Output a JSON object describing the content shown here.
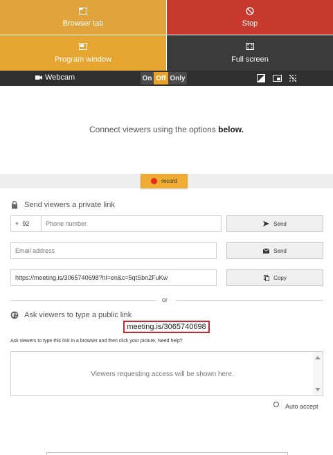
{
  "modes": {
    "browser_tab": {
      "label": "Browser tab",
      "icon": "browser-tab-icon"
    },
    "stop": {
      "label": "Stop",
      "icon": "stop-icon"
    },
    "program_window": {
      "label": "Program window",
      "icon": "program-window-icon"
    },
    "full_screen": {
      "label": "Full screen",
      "icon": "full-screen-icon"
    }
  },
  "webcam": {
    "label": "Webcam",
    "toggle": {
      "on": "On",
      "off": "Off",
      "only": "Only",
      "selected": "Off"
    }
  },
  "connect": {
    "text": "Connect viewers using the options ",
    "emphasis": "below."
  },
  "record": {
    "label": "record"
  },
  "private_link": {
    "title": "Send viewers a private link",
    "country_code": "92",
    "phone_placeholder": "Phone number",
    "send_sms_label": "Send",
    "email_placeholder": "Email address",
    "send_email_label": "Send",
    "link_value": "https://meeting.is/3065740698?hl=en&c=5qtSbn2FuKw",
    "copy_label": "Copy"
  },
  "or_text": "or",
  "public_link": {
    "title": "Ask viewers to type a public link",
    "url": "meeting.is/3065740698",
    "help": "Ask viewers to type this link in a browser and then click your picture. Need help?",
    "requests_placeholder": "Viewers requesting access will be shown here.",
    "auto_accept_label": "Auto accept",
    "auto_accept": false
  },
  "colors": {
    "tile_browser": "#e1a43c",
    "tile_stop": "#c7392c",
    "tile_program": "#e6a431",
    "tile_full": "#3b3b3b",
    "accent": "#efac33",
    "record_dot": "#e52b1d",
    "highlight": "#c8282b"
  }
}
